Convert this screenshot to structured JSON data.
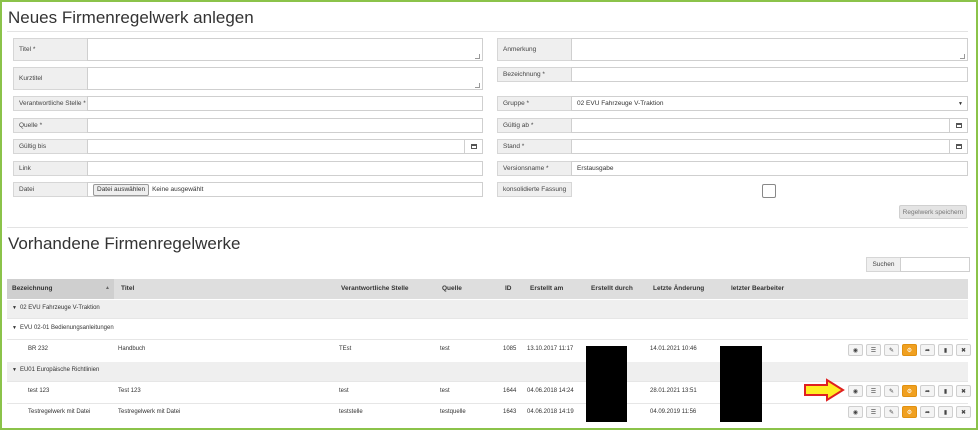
{
  "form": {
    "title": "Neues Firmenregelwerk anlegen",
    "fields": {
      "titel": {
        "label": "Titel *",
        "value": ""
      },
      "anmerkung": {
        "label": "Anmerkung",
        "value": ""
      },
      "kurztitel": {
        "label": "Kurztitel",
        "value": ""
      },
      "bezeichnung": {
        "label": "Bezeichnung *",
        "value": ""
      },
      "verantwortliche_stelle": {
        "label": "Verantwortliche Stelle *",
        "value": ""
      },
      "gruppe": {
        "label": "Gruppe *",
        "value": "02 EVU Fahrzeuge V-Traktion"
      },
      "quelle": {
        "label": "Quelle *",
        "value": ""
      },
      "gueltig_ab": {
        "label": "Gültig ab *",
        "value": ""
      },
      "gueltig_bis": {
        "label": "Gültig bis",
        "value": ""
      },
      "stand": {
        "label": "Stand *",
        "value": ""
      },
      "link": {
        "label": "Link",
        "value": ""
      },
      "versionsname": {
        "label": "Versionsname *",
        "value": "Erstausgabe"
      },
      "datei": {
        "label": "Datei",
        "button": "Datei auswählen",
        "status": "Keine ausgewählt"
      },
      "konsolidierte_fassung": {
        "label": "konsolidierte Fassung",
        "checked": false
      }
    },
    "save_label": "Regelwerk speichern"
  },
  "list": {
    "title": "Vorhandene Firmenregelwerke",
    "search_label": "Suchen",
    "search_value": "",
    "columns": {
      "bezeichnung": "Bezeichnung",
      "titel": "Titel",
      "verantwortliche_stelle": "Verantwortliche Stelle",
      "quelle": "Quelle",
      "id": "ID",
      "erstellt_am": "Erstellt am",
      "erstellt_durch": "Erstellt durch",
      "letzte_aenderung": "Letzte Änderung",
      "letzter_bearbeiter": "letzter Bearbeiter"
    },
    "groups": [
      "02 EVU Fahrzeuge V-Traktion",
      "EVU 02-01 Bedienungsanleitungen",
      "EU01 Europäische Richtlinien"
    ],
    "rows": [
      {
        "bezeichnung": "BR 232",
        "titel": "Handbuch",
        "stelle": "TEst",
        "quelle": "test",
        "id": "1085",
        "erstellt_am": "13.10.2017 11:17",
        "letzte_aenderung": "14.01.2021 10:46"
      },
      {
        "bezeichnung": "test 123",
        "titel": "Test 123",
        "stelle": "test",
        "quelle": "test",
        "id": "1644",
        "erstellt_am": "04.06.2018 14:24",
        "letzte_aenderung": "28.01.2021 13:51"
      },
      {
        "bezeichnung": "Testregelwerk mit Datei",
        "titel": "Testregelwerk mit Datei",
        "stelle": "teststelle",
        "quelle": "testquelle",
        "id": "1643",
        "erstellt_am": "04.06.2018 14:19",
        "letzte_aenderung": "04.09.2019 11:56"
      }
    ]
  },
  "icons": [
    "eye-icon",
    "database-icon",
    "edit-icon",
    "gear-icon",
    "share-icon",
    "book-icon",
    "trash-icon",
    "arrow-annotation"
  ],
  "colors": {
    "frame": "#8bc34a",
    "action_highlight": "#f0a020",
    "arrow_fill": "#ffee22",
    "arrow_stroke": "#e02020"
  }
}
